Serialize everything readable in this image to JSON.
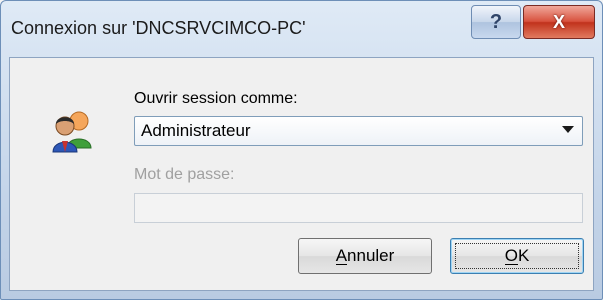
{
  "window": {
    "title": "Connexion sur 'DNCSRVCIMCO-PC'",
    "help_label": "?",
    "close_label": "X"
  },
  "form": {
    "user_label": "Ouvrir session comme:",
    "user_value": "Administrateur",
    "password_label": "Mot de passe:",
    "password_value": ""
  },
  "buttons": {
    "cancel_mnemonic": "A",
    "cancel_rest": "nnuler",
    "ok_mnemonic": "O",
    "ok_rest": "K"
  },
  "icons": {
    "user_icon": "users-icon",
    "dropdown_icon": "chevron-down-icon"
  },
  "colors": {
    "close_button": "#c1321c",
    "title_bar": "#c6d6ea",
    "ok_border": "#3c7fb1"
  }
}
